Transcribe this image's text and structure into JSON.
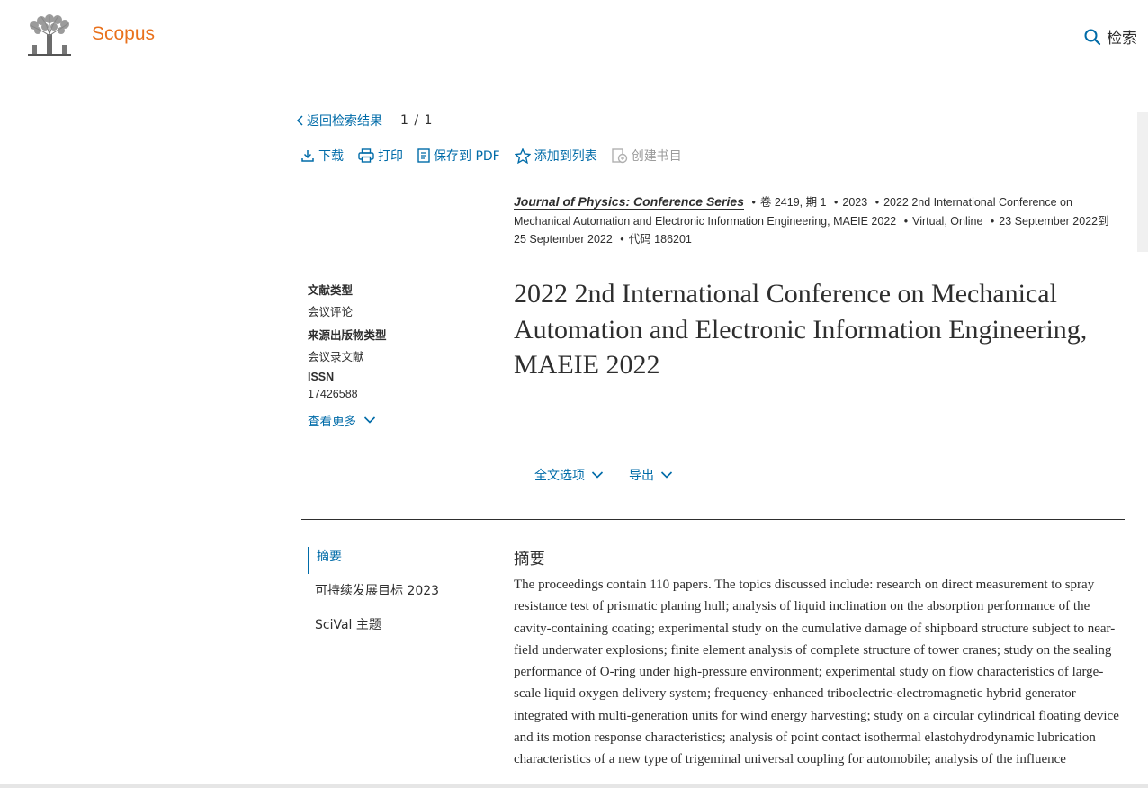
{
  "header": {
    "brand": "Scopus",
    "search_label": "检索"
  },
  "breadcrumb": {
    "back_label": "返回检索结果",
    "count": "1 / 1"
  },
  "toolbar": {
    "download": "下载",
    "print": "打印",
    "save_pdf": "保存到 PDF",
    "add_list": "添加到列表",
    "create_bib": "创建书目"
  },
  "source": {
    "journal": "Journal of Physics: Conference Series",
    "details": [
      "卷 2419, 期 1",
      "2023",
      "2022 2nd International Conference on Mechanical Automation and Electronic Information Engineering, MAEIE 2022",
      "Virtual, Online",
      "23 September 2022到 25 September 2022",
      "代码 186201"
    ]
  },
  "meta": {
    "doc_type_label": "文献类型",
    "doc_type_value": "会议评论",
    "source_type_label": "来源出版物类型",
    "source_type_value": "会议录文献",
    "issn_label": "ISSN",
    "issn_value": "17426588",
    "more_label": "查看更多"
  },
  "title": "2022 2nd International Conference on Mechanical Automation and Electronic Information Engineering, MAEIE 2022",
  "options": {
    "full_text": "全文选项",
    "export": "导出"
  },
  "sidenav": {
    "items": [
      "摘要",
      "可持续发展目标 2023",
      "SciVal 主题"
    ]
  },
  "abstract": {
    "heading": "摘要",
    "text": "The proceedings contain 110 papers. The topics discussed include: research on direct measurement to spray resistance test of prismatic planing hull; analysis of liquid inclination on the absorption performance of the cavity-containing coating; experimental study on the cumulative damage of shipboard structure subject to near-field underwater explosions; finite element analysis of complete structure of tower cranes; study on the sealing performance of O-ring under high-pressure environment; experimental study on flow characteristics of large-scale liquid oxygen delivery system; frequency-enhanced triboelectric-electromagnetic hybrid generator integrated with multi-generation units for wind energy harvesting; study on a circular cylindrical floating device and its motion response characteristics; analysis of point contact isothermal elastohydrodynamic lubrication characteristics of a new type of trigeminal universal coupling for automobile; analysis of the influence"
  },
  "colors": {
    "brand": "#e9711c",
    "link": "#006ba8",
    "text": "#2e2e2e",
    "disabled": "#9b9b9b"
  }
}
